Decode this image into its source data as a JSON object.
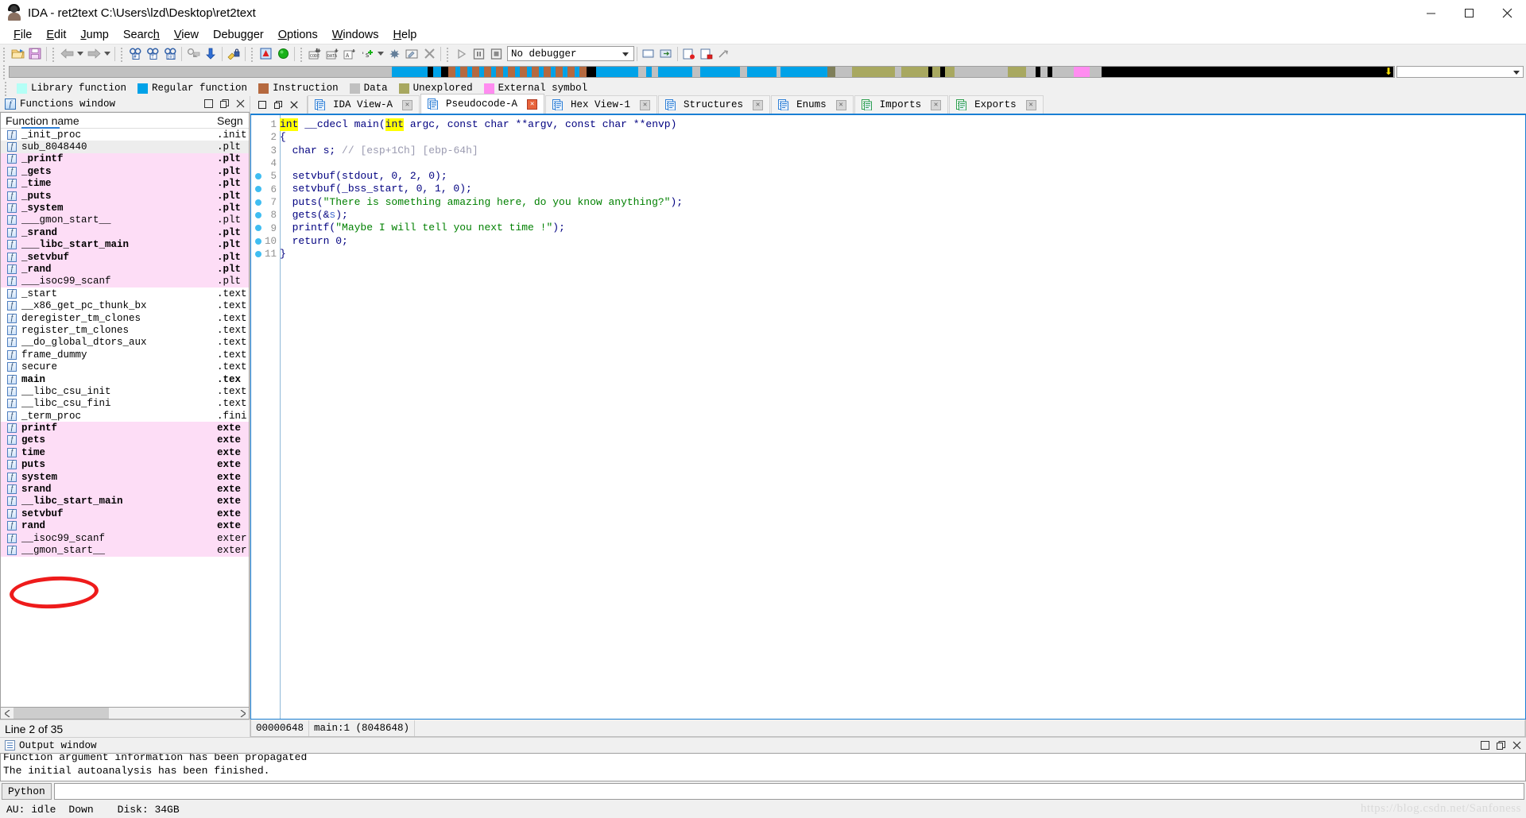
{
  "window": {
    "title": "IDA - ret2text C:\\Users\\lzd\\Desktop\\ret2text",
    "icon": "ida-logo-icon",
    "minimize": "–",
    "maximize": "❐",
    "close": "✕"
  },
  "menu": {
    "items": [
      {
        "label": "File",
        "accel": "F"
      },
      {
        "label": "Edit",
        "accel": "E"
      },
      {
        "label": "Jump",
        "accel": "J"
      },
      {
        "label": "Search",
        "accel": "h"
      },
      {
        "label": "View",
        "accel": "V"
      },
      {
        "label": "Debugger",
        "accel": "g"
      },
      {
        "label": "Options",
        "accel": "O"
      },
      {
        "label": "Windows",
        "accel": "W"
      },
      {
        "label": "Help",
        "accel": "H"
      }
    ]
  },
  "toolbar": {
    "debugger_select_value": "No debugger",
    "buttons": [
      "open-file-icon",
      "save-icon",
      "nav-back-icon",
      "nav-back-dropdown-icon",
      "nav-forward-icon",
      "nav-forward-dropdown-icon",
      "search-hash-icon",
      "search-text-icon",
      "search-binary-icon",
      "search-next-icon",
      "jump-down-icon",
      "decrypt-key-icon",
      "warning-icon",
      "run-green-icon",
      "make-code-icon",
      "make-data-icon",
      "make-ascii-icon",
      "make-struct-icon",
      "make-dropdown-icon",
      "undefine-icon",
      "edit-function-icon",
      "delete-icon",
      "run-debugger-icon",
      "pause-icon",
      "stop-icon"
    ]
  },
  "navigator": {
    "marker": "⬇",
    "segments": [
      {
        "color": "#c0c0c0",
        "width": 28.8
      },
      {
        "color": "#00a2e8",
        "width": 2.7
      },
      {
        "color": "#000000",
        "width": 0.45
      },
      {
        "color": "#00a2e8",
        "width": 0.6
      },
      {
        "color": "#000000",
        "width": 0.5
      },
      {
        "color": "#b5693f",
        "width": 0.55
      },
      {
        "color": "#00a2e8",
        "width": 0.35
      },
      {
        "color": "#b5693f",
        "width": 0.55
      },
      {
        "color": "#00a2e8",
        "width": 0.35
      },
      {
        "color": "#b5693f",
        "width": 0.55
      },
      {
        "color": "#00a2e8",
        "width": 0.35
      },
      {
        "color": "#b5693f",
        "width": 0.55
      },
      {
        "color": "#00a2e8",
        "width": 0.35
      },
      {
        "color": "#b5693f",
        "width": 0.55
      },
      {
        "color": "#00a2e8",
        "width": 0.35
      },
      {
        "color": "#b5693f",
        "width": 0.55
      },
      {
        "color": "#00a2e8",
        "width": 0.35
      },
      {
        "color": "#b5693f",
        "width": 0.55
      },
      {
        "color": "#00a2e8",
        "width": 0.35
      },
      {
        "color": "#b5693f",
        "width": 0.55
      },
      {
        "color": "#00a2e8",
        "width": 0.35
      },
      {
        "color": "#b5693f",
        "width": 0.55
      },
      {
        "color": "#00a2e8",
        "width": 0.35
      },
      {
        "color": "#b5693f",
        "width": 0.55
      },
      {
        "color": "#00a2e8",
        "width": 0.35
      },
      {
        "color": "#b5693f",
        "width": 0.55
      },
      {
        "color": "#00a2e8",
        "width": 0.35
      },
      {
        "color": "#b5693f",
        "width": 0.55
      },
      {
        "color": "#000000",
        "width": 0.7
      },
      {
        "color": "#00a2e8",
        "width": 3.2
      },
      {
        "color": "#c0c0c0",
        "width": 0.6
      },
      {
        "color": "#00a2e8",
        "width": 0.4
      },
      {
        "color": "#c0c0c0",
        "width": 0.5
      },
      {
        "color": "#00a2e8",
        "width": 2.6
      },
      {
        "color": "#c0c0c0",
        "width": 0.6
      },
      {
        "color": "#00a2e8",
        "width": 3.0
      },
      {
        "color": "#c0c0c0",
        "width": 0.5
      },
      {
        "color": "#00a2e8",
        "width": 2.2
      },
      {
        "color": "#c0c0c0",
        "width": 0.35
      },
      {
        "color": "#00a2e8",
        "width": 3.5
      },
      {
        "color": "#7f7f5a",
        "width": 0.6
      },
      {
        "color": "#c0c0c0",
        "width": 1.3
      },
      {
        "color": "#a8a860",
        "width": 3.2
      },
      {
        "color": "#c0c0c0",
        "width": 0.5
      },
      {
        "color": "#a8a860",
        "width": 2.0
      },
      {
        "color": "#000000",
        "width": 0.35
      },
      {
        "color": "#a8a860",
        "width": 0.6
      },
      {
        "color": "#000000",
        "width": 0.35
      },
      {
        "color": "#a8a860",
        "width": 0.7
      },
      {
        "color": "#c0c0c0",
        "width": 4.0
      },
      {
        "color": "#a8a860",
        "width": 1.4
      },
      {
        "color": "#c0c0c0",
        "width": 0.7
      },
      {
        "color": "#000000",
        "width": 0.4
      },
      {
        "color": "#c0c0c0",
        "width": 0.5
      },
      {
        "color": "#000000",
        "width": 0.4
      },
      {
        "color": "#c0c0c0",
        "width": 1.6
      },
      {
        "color": "#ff8cf0",
        "width": 1.2
      },
      {
        "color": "#c0c0c0",
        "width": 0.9
      },
      {
        "color": "#000000",
        "width": 22.0
      }
    ]
  },
  "legend": {
    "items": [
      {
        "label": "Library function",
        "color": "#b4fff6"
      },
      {
        "label": "Regular function",
        "color": "#00a2e8"
      },
      {
        "label": "Instruction",
        "color": "#b5693f"
      },
      {
        "label": "Data",
        "color": "#c0c0c0"
      },
      {
        "label": "Unexplored",
        "color": "#a8a860"
      },
      {
        "label": "External symbol",
        "color": "#ff8cf0"
      }
    ]
  },
  "functions_window": {
    "caption": "Functions window",
    "caption_icon": "function-f-icon",
    "caption_buttons": [
      "restore-window-icon",
      "float-window-icon",
      "close-window-icon"
    ],
    "columns": [
      "Function name",
      "Segn"
    ],
    "status": "Line 2 of 35",
    "rows": [
      {
        "name": "_init_proc",
        "segment": ".init",
        "style": "normal"
      },
      {
        "name": "sub_8048440",
        "segment": ".plt",
        "style": "selected"
      },
      {
        "name": "_printf",
        "segment": ".plt",
        "style": "lib-bold"
      },
      {
        "name": "_gets",
        "segment": ".plt",
        "style": "lib-bold"
      },
      {
        "name": "_time",
        "segment": ".plt",
        "style": "lib-bold"
      },
      {
        "name": "_puts",
        "segment": ".plt",
        "style": "lib-bold"
      },
      {
        "name": "_system",
        "segment": ".plt",
        "style": "lib-bold"
      },
      {
        "name": "___gmon_start__",
        "segment": ".plt",
        "style": "lib"
      },
      {
        "name": "_srand",
        "segment": ".plt",
        "style": "lib-bold"
      },
      {
        "name": "___libc_start_main",
        "segment": ".plt",
        "style": "lib-bold"
      },
      {
        "name": "_setvbuf",
        "segment": ".plt",
        "style": "lib-bold"
      },
      {
        "name": "_rand",
        "segment": ".plt",
        "style": "lib-bold"
      },
      {
        "name": "___isoc99_scanf",
        "segment": ".plt",
        "style": "lib"
      },
      {
        "name": "_start",
        "segment": ".text",
        "style": "normal"
      },
      {
        "name": "__x86_get_pc_thunk_bx",
        "segment": ".text",
        "style": "normal"
      },
      {
        "name": "deregister_tm_clones",
        "segment": ".text",
        "style": "normal"
      },
      {
        "name": "register_tm_clones",
        "segment": ".text",
        "style": "normal"
      },
      {
        "name": "__do_global_dtors_aux",
        "segment": ".text",
        "style": "normal"
      },
      {
        "name": "frame_dummy",
        "segment": ".text",
        "style": "normal"
      },
      {
        "name": "secure",
        "segment": ".text",
        "style": "normal"
      },
      {
        "name": "main",
        "segment": ".tex",
        "style": "bold"
      },
      {
        "name": "__libc_csu_init",
        "segment": ".text",
        "style": "normal"
      },
      {
        "name": "__libc_csu_fini",
        "segment": ".text",
        "style": "normal"
      },
      {
        "name": "_term_proc",
        "segment": ".fini",
        "style": "normal"
      },
      {
        "name": "printf",
        "segment": "exte",
        "style": "ext-bold"
      },
      {
        "name": "gets",
        "segment": "exte",
        "style": "ext-bold"
      },
      {
        "name": "time",
        "segment": "exte",
        "style": "ext-bold"
      },
      {
        "name": "puts",
        "segment": "exte",
        "style": "ext-bold"
      },
      {
        "name": "system",
        "segment": "exte",
        "style": "ext-bold"
      },
      {
        "name": "srand",
        "segment": "exte",
        "style": "ext-bold"
      },
      {
        "name": "__libc_start_main",
        "segment": "exte",
        "style": "ext-bold"
      },
      {
        "name": "setvbuf",
        "segment": "exte",
        "style": "ext-bold"
      },
      {
        "name": "rand",
        "segment": "exte",
        "style": "ext-bold"
      },
      {
        "name": "__isoc99_scanf",
        "segment": "exter",
        "style": "ext"
      },
      {
        "name": "__gmon_start__",
        "segment": "exter",
        "style": "ext"
      }
    ]
  },
  "annotation": {
    "shape": "red-ellipse",
    "color": "#ee1b1b",
    "targets": [
      "system"
    ]
  },
  "tabs": {
    "controls": [
      "restore-icon",
      "tile-icon",
      "close-icon"
    ],
    "items": [
      {
        "label": "IDA View-A",
        "icon": "ida-view-icon",
        "active": false,
        "close": "grey"
      },
      {
        "label": "Pseudocode-A",
        "icon": "pseudocode-icon",
        "active": true,
        "close": "red"
      },
      {
        "label": "Hex View-1",
        "icon": "hex-view-icon",
        "active": false,
        "close": "grey"
      },
      {
        "label": "Structures",
        "icon": "structures-icon",
        "active": false,
        "close": "grey"
      },
      {
        "label": "Enums",
        "icon": "enums-icon",
        "active": false,
        "close": "grey"
      },
      {
        "label": "Imports",
        "icon": "imports-icon",
        "active": false,
        "close": "grey"
      },
      {
        "label": "Exports",
        "icon": "exports-icon",
        "active": false,
        "close": "grey"
      }
    ]
  },
  "pseudocode": {
    "status_address": "00000648",
    "status_location": "main:1",
    "status_ea": "(8048648)",
    "lines": [
      {
        "n": "1",
        "breakpoint": false,
        "tokens": [
          {
            "t": "int",
            "c": "hl"
          },
          {
            "t": " ",
            "c": "plain"
          },
          {
            "t": "__cdecl",
            "c": "kw"
          },
          {
            "t": " ",
            "c": "plain"
          },
          {
            "t": "main",
            "c": "plain"
          },
          {
            "t": "(",
            "c": "plain"
          },
          {
            "t": "int",
            "c": "hl"
          },
          {
            "t": " argc, ",
            "c": "plain"
          },
          {
            "t": "const",
            "c": "kw"
          },
          {
            "t": " ",
            "c": "plain"
          },
          {
            "t": "char",
            "c": "kw"
          },
          {
            "t": " **argv, ",
            "c": "plain"
          },
          {
            "t": "const",
            "c": "kw"
          },
          {
            "t": " ",
            "c": "plain"
          },
          {
            "t": "char",
            "c": "kw"
          },
          {
            "t": " **envp)",
            "c": "plain"
          }
        ]
      },
      {
        "n": "2",
        "breakpoint": false,
        "tokens": [
          {
            "t": "{",
            "c": "plain"
          }
        ]
      },
      {
        "n": "3",
        "breakpoint": false,
        "tokens": [
          {
            "t": "  ",
            "c": "plain"
          },
          {
            "t": "char",
            "c": "kw"
          },
          {
            "t": " s; ",
            "c": "plain"
          },
          {
            "t": "// [esp+1Ch] [ebp-64h]",
            "c": "cmt"
          }
        ]
      },
      {
        "n": "4",
        "breakpoint": false,
        "tokens": []
      },
      {
        "n": "5",
        "breakpoint": true,
        "tokens": [
          {
            "t": "  setvbuf(stdout, 0, 2, 0);",
            "c": "plain"
          }
        ]
      },
      {
        "n": "6",
        "breakpoint": true,
        "tokens": [
          {
            "t": "  setvbuf(_bss_start, 0, 1, 0);",
            "c": "plain"
          }
        ]
      },
      {
        "n": "7",
        "breakpoint": true,
        "tokens": [
          {
            "t": "  puts(",
            "c": "plain"
          },
          {
            "t": "\"There is something amazing here, do you know anything?\"",
            "c": "str"
          },
          {
            "t": ");",
            "c": "plain"
          }
        ]
      },
      {
        "n": "8",
        "breakpoint": true,
        "tokens": [
          {
            "t": "  gets(&",
            "c": "plain"
          },
          {
            "t": "s",
            "c": "var"
          },
          {
            "t": ");",
            "c": "plain"
          }
        ]
      },
      {
        "n": "9",
        "breakpoint": true,
        "tokens": [
          {
            "t": "  printf(",
            "c": "plain"
          },
          {
            "t": "\"Maybe I will tell you next time !\"",
            "c": "str"
          },
          {
            "t": ");",
            "c": "plain"
          }
        ]
      },
      {
        "n": "10",
        "breakpoint": true,
        "tokens": [
          {
            "t": "  ",
            "c": "plain"
          },
          {
            "t": "return",
            "c": "kw"
          },
          {
            "t": " 0;",
            "c": "plain"
          }
        ]
      },
      {
        "n": "11",
        "breakpoint": true,
        "tokens": [
          {
            "t": "}",
            "c": "plain"
          }
        ]
      }
    ]
  },
  "output_window": {
    "caption": "Output window",
    "caption_icon": "output-list-icon",
    "lines": [
      "Function argument information has been propagated",
      "The initial autoanalysis has been finished."
    ],
    "cli_button": "Python",
    "cli_value": "",
    "cli_placeholder": ""
  },
  "statusbar": {
    "au": "AU: idle",
    "down": "Down",
    "disk": "Disk: 34GB",
    "watermark": "https://blog.csdn.net/Sanfoness"
  }
}
